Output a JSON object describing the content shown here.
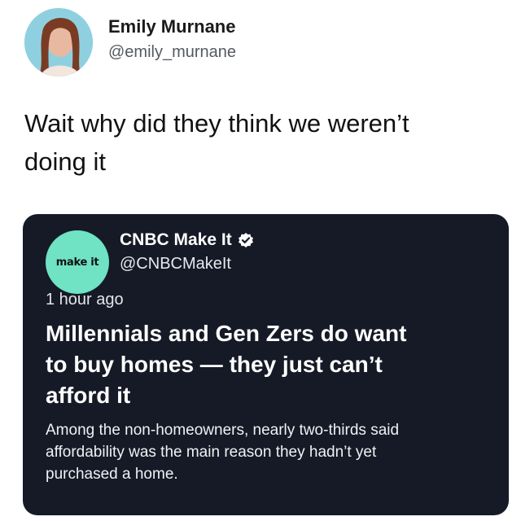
{
  "author": {
    "name": "Emily Murnane",
    "handle": "@emily_murnane"
  },
  "tweet": {
    "text_line1": "Wait why did they think we weren’t",
    "text_line2": "doing it"
  },
  "quoted": {
    "brand_logo_text": "make it",
    "name": "CNBC Make It",
    "verified_icon": "verified-badge-icon",
    "handle": "@CNBCMakeIt",
    "time": "1 hour ago",
    "headline_line1": "Millennials and Gen Zers do want",
    "headline_line2": "to buy homes — they just can’t",
    "headline_line3": "afford it",
    "summary_line1": "Among the non-homeowners, nearly two-thirds said",
    "summary_line2": "affordability was the main reason they hadn’t yet",
    "summary_line3": "purchased a home."
  },
  "colors": {
    "card_background": "#151a26",
    "brand_accent": "#6fe3c4",
    "avatar_background": "#8fd0e0"
  }
}
